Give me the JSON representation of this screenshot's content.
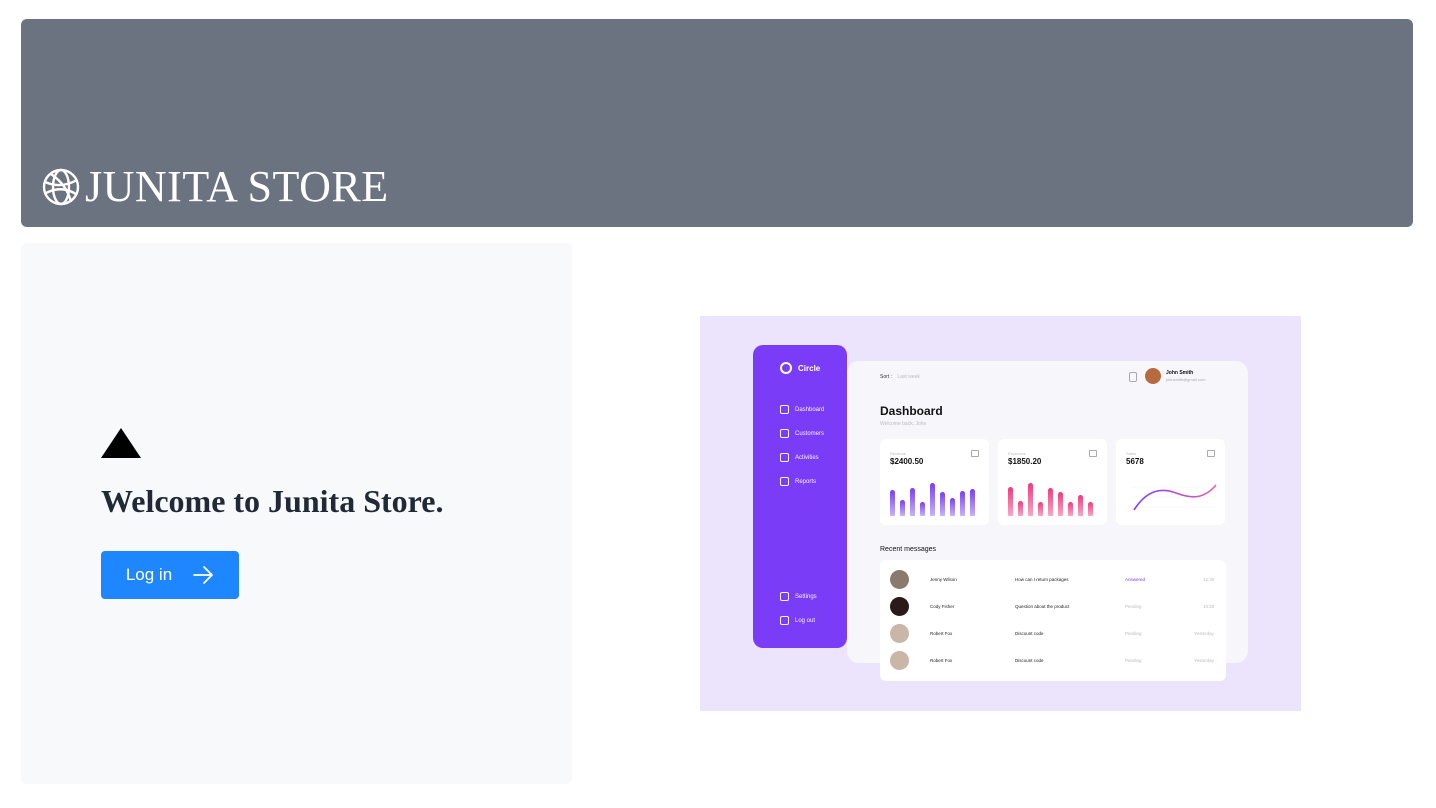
{
  "header": {
    "brand_name": "JUNITA STORE",
    "brand_icon": "globe-icon",
    "background": "#6b7280"
  },
  "welcome": {
    "logo_icon": "triangle-logo-icon",
    "title": "Welcome to Junita Store.",
    "login_label": "Log in",
    "login_icon": "arrow-right-icon",
    "login_color": "#1e86ff"
  },
  "illustration": {
    "app_name": "Circle",
    "nav": [
      "Dashboard",
      "Customers",
      "Activities",
      "Reports",
      "Settings",
      "Log out"
    ],
    "sort_label": "Sort :",
    "sort_value": "Last week",
    "user_name": "John Smith",
    "user_email": "johnsmith@gmail.com",
    "page_title": "Dashboard",
    "page_subtitle": "Welcome back, John",
    "cards": [
      {
        "label": "Revenue",
        "value": "$2400.50"
      },
      {
        "label": "Expenses",
        "value": "$1850.20"
      },
      {
        "label": "Sales",
        "value": "5678"
      }
    ],
    "recent_title": "Recent messages",
    "messages": [
      {
        "name": "Jenny Wilson",
        "subject": "How can I return packages",
        "status": "Answered",
        "time": "12:30"
      },
      {
        "name": "Cody Fisher",
        "subject": "Question about the product",
        "status": "Pending",
        "time": "10:20"
      },
      {
        "name": "Robert Fox",
        "subject": "Discount code",
        "status": "Pending",
        "time": "Yesterday"
      },
      {
        "name": "Robert Fox",
        "subject": "Discount code",
        "status": "Pending",
        "time": "Yesterday"
      }
    ]
  }
}
